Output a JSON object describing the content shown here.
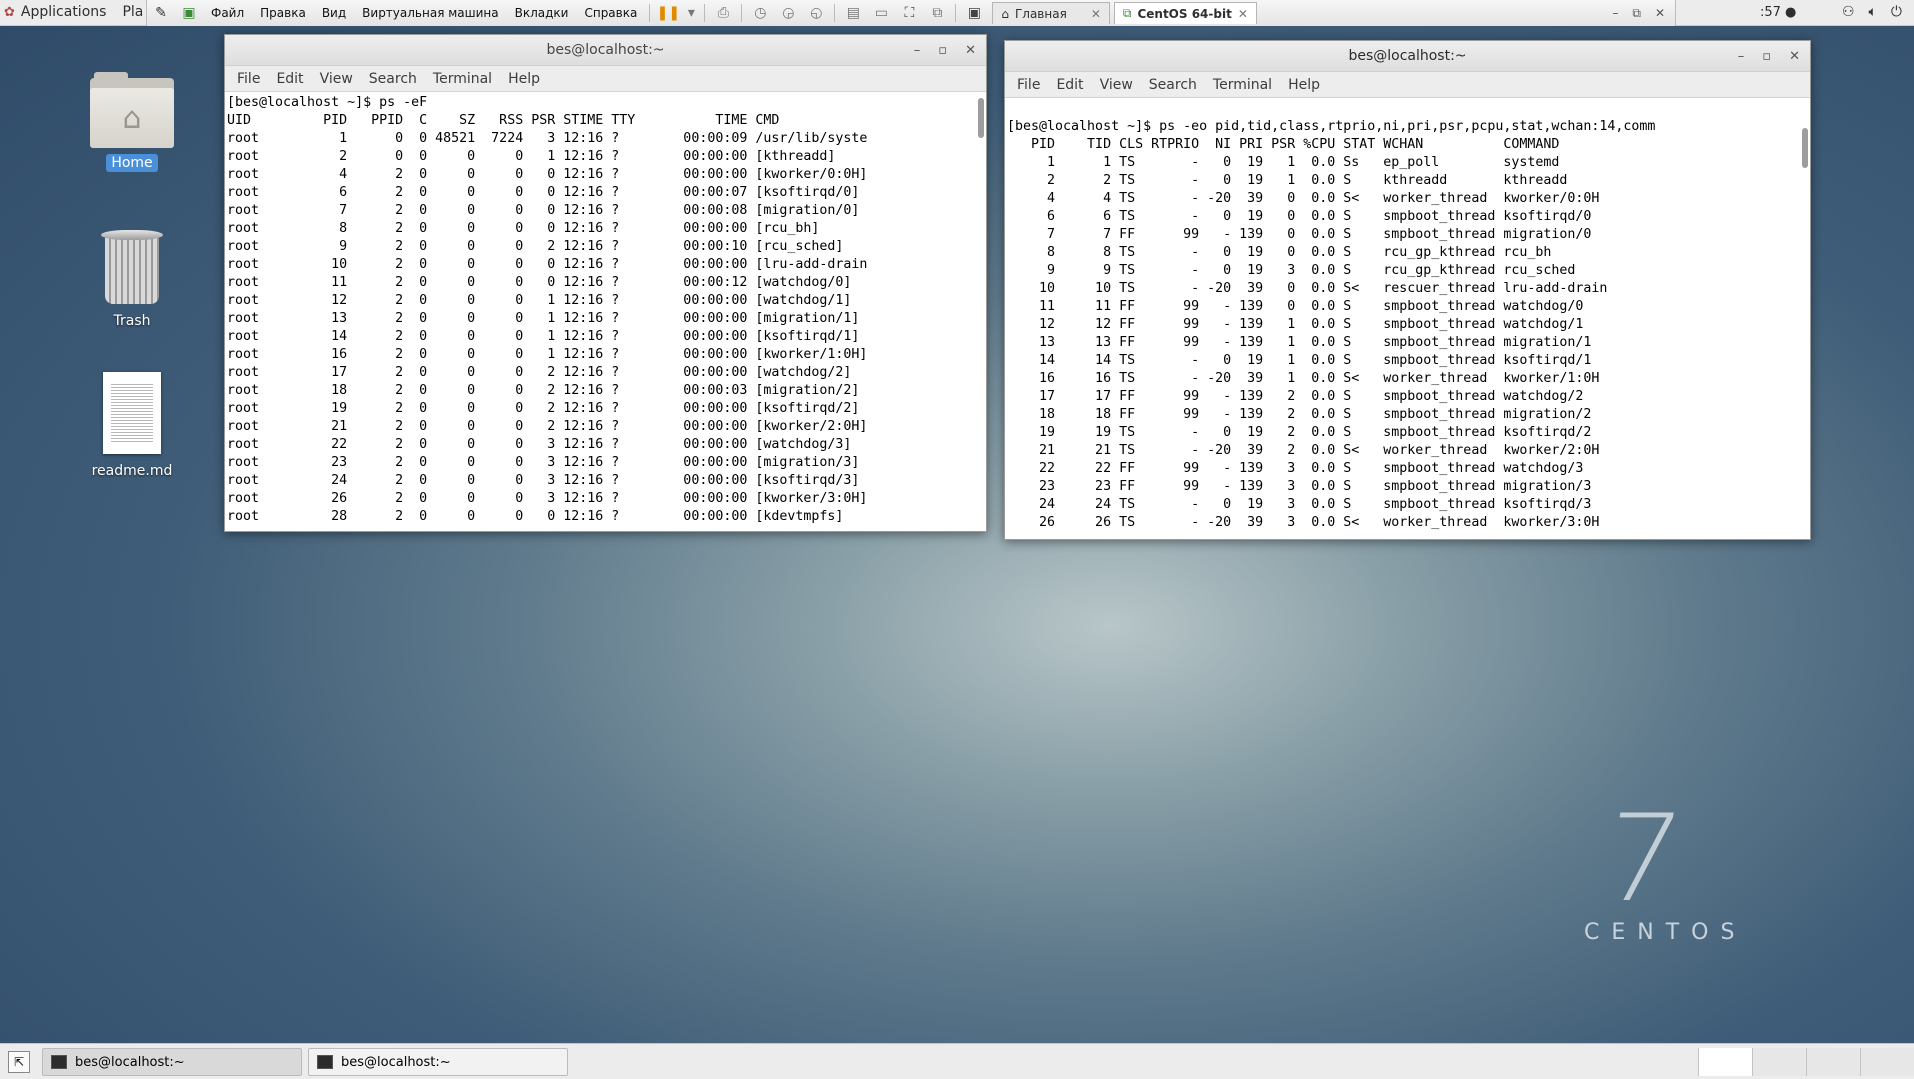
{
  "topbar": {
    "applications": "Applications",
    "places": "Pla",
    "clock": ":57 ●",
    "vm_menus": [
      "Файл",
      "Правка",
      "Вид",
      "Виртуальная машина",
      "Вкладки",
      "Справка"
    ],
    "tabs": [
      {
        "label": "Главная",
        "active": false
      },
      {
        "label": "CentOS 64-bit",
        "active": true
      }
    ]
  },
  "desktop": {
    "icons": [
      {
        "label": "Home",
        "selected": true
      },
      {
        "label": "Trash",
        "selected": false
      },
      {
        "label": "readme.md",
        "selected": false
      }
    ],
    "logo_number": "7",
    "logo_word": "CENTOS"
  },
  "terminal_left": {
    "title": "bes@localhost:~",
    "menu": [
      "File",
      "Edit",
      "View",
      "Search",
      "Terminal",
      "Help"
    ],
    "output": "[bes@localhost ~]$ ps -eF\nUID         PID   PPID  C    SZ   RSS PSR STIME TTY          TIME CMD\nroot          1      0  0 48521  7224   3 12:16 ?        00:00:09 /usr/lib/syste\nroot          2      0  0     0     0   1 12:16 ?        00:00:00 [kthreadd]\nroot          4      2  0     0     0   0 12:16 ?        00:00:00 [kworker/0:0H]\nroot          6      2  0     0     0   0 12:16 ?        00:00:07 [ksoftirqd/0]\nroot          7      2  0     0     0   0 12:16 ?        00:00:08 [migration/0]\nroot          8      2  0     0     0   0 12:16 ?        00:00:00 [rcu_bh]\nroot          9      2  0     0     0   2 12:16 ?        00:00:10 [rcu_sched]\nroot         10      2  0     0     0   0 12:16 ?        00:00:00 [lru-add-drain\nroot         11      2  0     0     0   0 12:16 ?        00:00:12 [watchdog/0]\nroot         12      2  0     0     0   1 12:16 ?        00:00:00 [watchdog/1]\nroot         13      2  0     0     0   1 12:16 ?        00:00:00 [migration/1]\nroot         14      2  0     0     0   1 12:16 ?        00:00:00 [ksoftirqd/1]\nroot         16      2  0     0     0   1 12:16 ?        00:00:00 [kworker/1:0H]\nroot         17      2  0     0     0   2 12:16 ?        00:00:00 [watchdog/2]\nroot         18      2  0     0     0   2 12:16 ?        00:00:03 [migration/2]\nroot         19      2  0     0     0   2 12:16 ?        00:00:00 [ksoftirqd/2]\nroot         21      2  0     0     0   2 12:16 ?        00:00:00 [kworker/2:0H]\nroot         22      2  0     0     0   3 12:16 ?        00:00:00 [watchdog/3]\nroot         23      2  0     0     0   3 12:16 ?        00:00:00 [migration/3]\nroot         24      2  0     0     0   3 12:16 ?        00:00:00 [ksoftirqd/3]\nroot         26      2  0     0     0   3 12:16 ?        00:00:00 [kworker/3:0H]\nroot         28      2  0     0     0   0 12:16 ?        00:00:00 [kdevtmpfs]"
  },
  "terminal_right": {
    "title": "bes@localhost:~",
    "menu": [
      "File",
      "Edit",
      "View",
      "Search",
      "Terminal",
      "Help"
    ],
    "output": "\n[bes@localhost ~]$ ps -eo pid,tid,class,rtprio,ni,pri,psr,pcpu,stat,wchan:14,comm\n   PID    TID CLS RTPRIO  NI PRI PSR %CPU STAT WCHAN          COMMAND\n     1      1 TS       -   0  19   1  0.0 Ss   ep_poll        systemd\n     2      2 TS       -   0  19   1  0.0 S    kthreadd       kthreadd\n     4      4 TS       - -20  39   0  0.0 S<   worker_thread  kworker/0:0H\n     6      6 TS       -   0  19   0  0.0 S    smpboot_thread ksoftirqd/0\n     7      7 FF      99   - 139   0  0.0 S    smpboot_thread migration/0\n     8      8 TS       -   0  19   0  0.0 S    rcu_gp_kthread rcu_bh\n     9      9 TS       -   0  19   3  0.0 S    rcu_gp_kthread rcu_sched\n    10     10 TS       - -20  39   0  0.0 S<   rescuer_thread lru-add-drain\n    11     11 FF      99   - 139   0  0.0 S    smpboot_thread watchdog/0\n    12     12 FF      99   - 139   1  0.0 S    smpboot_thread watchdog/1\n    13     13 FF      99   - 139   1  0.0 S    smpboot_thread migration/1\n    14     14 TS       -   0  19   1  0.0 S    smpboot_thread ksoftirqd/1\n    16     16 TS       - -20  39   1  0.0 S<   worker_thread  kworker/1:0H\n    17     17 FF      99   - 139   2  0.0 S    smpboot_thread watchdog/2\n    18     18 FF      99   - 139   2  0.0 S    smpboot_thread migration/2\n    19     19 TS       -   0  19   2  0.0 S    smpboot_thread ksoftirqd/2\n    21     21 TS       - -20  39   2  0.0 S<   worker_thread  kworker/2:0H\n    22     22 FF      99   - 139   3  0.0 S    smpboot_thread watchdog/3\n    23     23 FF      99   - 139   3  0.0 S    smpboot_thread migration/3\n    24     24 TS       -   0  19   3  0.0 S    smpboot_thread ksoftirqd/3\n    26     26 TS       - -20  39   3  0.0 S<   worker_thread  kworker/3:0H"
  },
  "taskbar": {
    "tasks": [
      {
        "label": "bes@localhost:~",
        "active": true
      },
      {
        "label": "bes@localhost:~",
        "active": false
      }
    ]
  }
}
